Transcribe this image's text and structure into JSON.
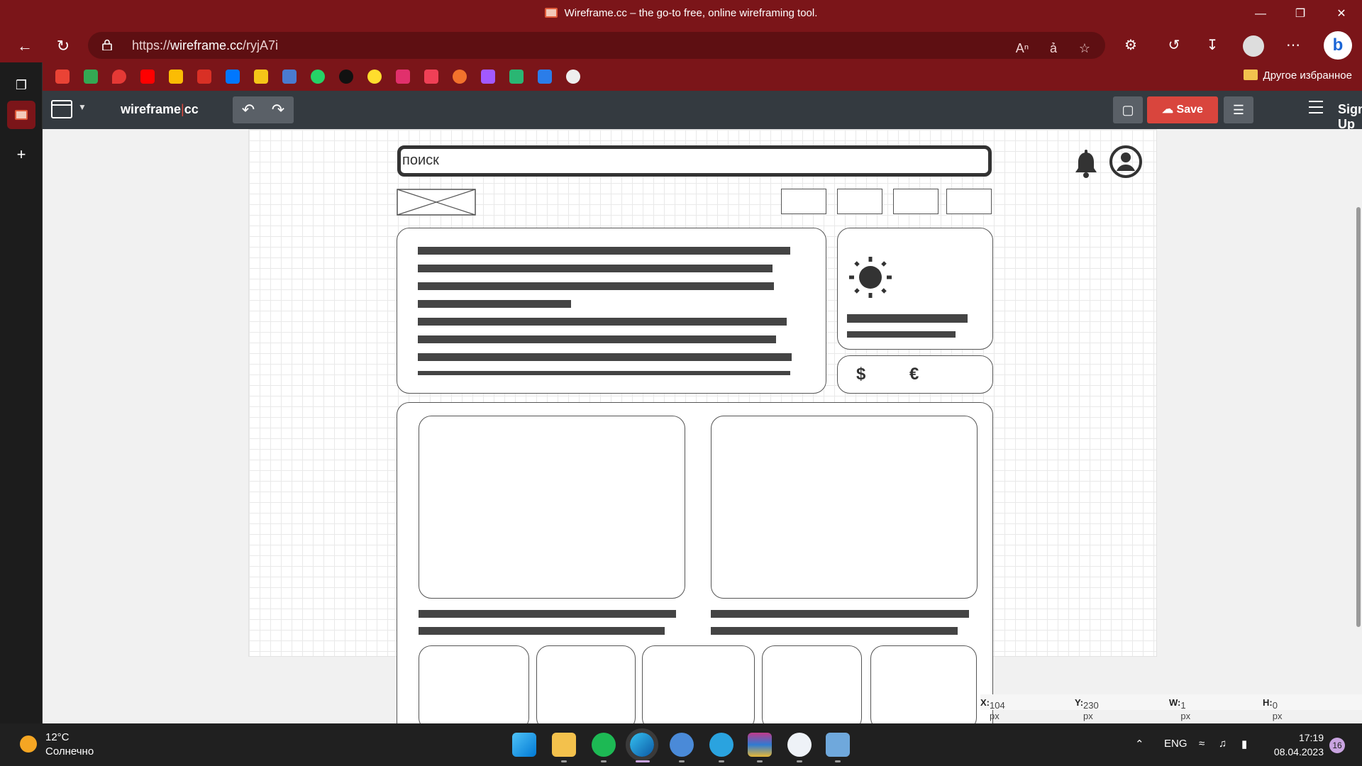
{
  "window": {
    "title": "Wireframe.cc – the go-to free, online wireframing tool."
  },
  "browser": {
    "url_prefix": "https://",
    "url_host": "wireframe.cc",
    "url_path": "/ryjA7i",
    "other_favorites": "Другое избранное"
  },
  "app": {
    "logo_main": "wireframe",
    "logo_sep": "|",
    "logo_cc": "cc",
    "save_label": "Save",
    "signup_label": "Sign Up"
  },
  "wireframe": {
    "search_text": "поиск",
    "currency_dollar": "$",
    "currency_euro": "€"
  },
  "status": {
    "x_label": "X:",
    "x_value": "104 px",
    "y_label": "Y:",
    "y_value": "230 px",
    "w_label": "W:",
    "w_value": "1 px",
    "h_label": "H:",
    "h_value": "0 px"
  },
  "taskbar": {
    "temperature": "12°C",
    "weather": "Солнечно",
    "lang": "ENG",
    "time": "17:19",
    "date": "08.04.2023",
    "notifications": "16"
  },
  "colors": {
    "browser_chrome": "#7b1519",
    "app_toolbar": "#343a40",
    "save_button": "#d9453d"
  }
}
